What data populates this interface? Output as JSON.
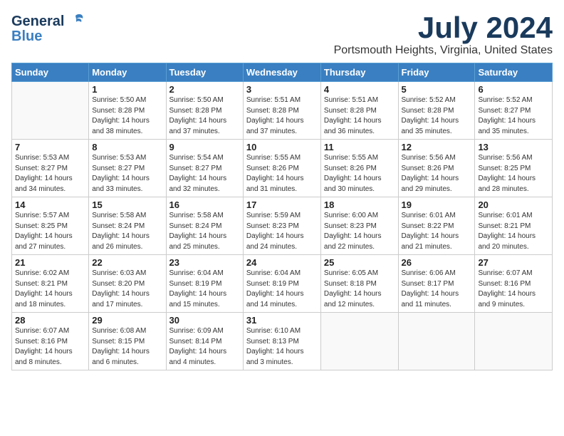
{
  "header": {
    "logo_line1": "General",
    "logo_line2": "Blue",
    "month_year": "July 2024",
    "location": "Portsmouth Heights, Virginia, United States"
  },
  "weekdays": [
    "Sunday",
    "Monday",
    "Tuesday",
    "Wednesday",
    "Thursday",
    "Friday",
    "Saturday"
  ],
  "weeks": [
    [
      {
        "day": "",
        "info": ""
      },
      {
        "day": "1",
        "info": "Sunrise: 5:50 AM\nSunset: 8:28 PM\nDaylight: 14 hours\nand 38 minutes."
      },
      {
        "day": "2",
        "info": "Sunrise: 5:50 AM\nSunset: 8:28 PM\nDaylight: 14 hours\nand 37 minutes."
      },
      {
        "day": "3",
        "info": "Sunrise: 5:51 AM\nSunset: 8:28 PM\nDaylight: 14 hours\nand 37 minutes."
      },
      {
        "day": "4",
        "info": "Sunrise: 5:51 AM\nSunset: 8:28 PM\nDaylight: 14 hours\nand 36 minutes."
      },
      {
        "day": "5",
        "info": "Sunrise: 5:52 AM\nSunset: 8:28 PM\nDaylight: 14 hours\nand 35 minutes."
      },
      {
        "day": "6",
        "info": "Sunrise: 5:52 AM\nSunset: 8:27 PM\nDaylight: 14 hours\nand 35 minutes."
      }
    ],
    [
      {
        "day": "7",
        "info": "Sunrise: 5:53 AM\nSunset: 8:27 PM\nDaylight: 14 hours\nand 34 minutes."
      },
      {
        "day": "8",
        "info": "Sunrise: 5:53 AM\nSunset: 8:27 PM\nDaylight: 14 hours\nand 33 minutes."
      },
      {
        "day": "9",
        "info": "Sunrise: 5:54 AM\nSunset: 8:27 PM\nDaylight: 14 hours\nand 32 minutes."
      },
      {
        "day": "10",
        "info": "Sunrise: 5:55 AM\nSunset: 8:26 PM\nDaylight: 14 hours\nand 31 minutes."
      },
      {
        "day": "11",
        "info": "Sunrise: 5:55 AM\nSunset: 8:26 PM\nDaylight: 14 hours\nand 30 minutes."
      },
      {
        "day": "12",
        "info": "Sunrise: 5:56 AM\nSunset: 8:26 PM\nDaylight: 14 hours\nand 29 minutes."
      },
      {
        "day": "13",
        "info": "Sunrise: 5:56 AM\nSunset: 8:25 PM\nDaylight: 14 hours\nand 28 minutes."
      }
    ],
    [
      {
        "day": "14",
        "info": "Sunrise: 5:57 AM\nSunset: 8:25 PM\nDaylight: 14 hours\nand 27 minutes."
      },
      {
        "day": "15",
        "info": "Sunrise: 5:58 AM\nSunset: 8:24 PM\nDaylight: 14 hours\nand 26 minutes."
      },
      {
        "day": "16",
        "info": "Sunrise: 5:58 AM\nSunset: 8:24 PM\nDaylight: 14 hours\nand 25 minutes."
      },
      {
        "day": "17",
        "info": "Sunrise: 5:59 AM\nSunset: 8:23 PM\nDaylight: 14 hours\nand 24 minutes."
      },
      {
        "day": "18",
        "info": "Sunrise: 6:00 AM\nSunset: 8:23 PM\nDaylight: 14 hours\nand 22 minutes."
      },
      {
        "day": "19",
        "info": "Sunrise: 6:01 AM\nSunset: 8:22 PM\nDaylight: 14 hours\nand 21 minutes."
      },
      {
        "day": "20",
        "info": "Sunrise: 6:01 AM\nSunset: 8:21 PM\nDaylight: 14 hours\nand 20 minutes."
      }
    ],
    [
      {
        "day": "21",
        "info": "Sunrise: 6:02 AM\nSunset: 8:21 PM\nDaylight: 14 hours\nand 18 minutes."
      },
      {
        "day": "22",
        "info": "Sunrise: 6:03 AM\nSunset: 8:20 PM\nDaylight: 14 hours\nand 17 minutes."
      },
      {
        "day": "23",
        "info": "Sunrise: 6:04 AM\nSunset: 8:19 PM\nDaylight: 14 hours\nand 15 minutes."
      },
      {
        "day": "24",
        "info": "Sunrise: 6:04 AM\nSunset: 8:19 PM\nDaylight: 14 hours\nand 14 minutes."
      },
      {
        "day": "25",
        "info": "Sunrise: 6:05 AM\nSunset: 8:18 PM\nDaylight: 14 hours\nand 12 minutes."
      },
      {
        "day": "26",
        "info": "Sunrise: 6:06 AM\nSunset: 8:17 PM\nDaylight: 14 hours\nand 11 minutes."
      },
      {
        "day": "27",
        "info": "Sunrise: 6:07 AM\nSunset: 8:16 PM\nDaylight: 14 hours\nand 9 minutes."
      }
    ],
    [
      {
        "day": "28",
        "info": "Sunrise: 6:07 AM\nSunset: 8:16 PM\nDaylight: 14 hours\nand 8 minutes."
      },
      {
        "day": "29",
        "info": "Sunrise: 6:08 AM\nSunset: 8:15 PM\nDaylight: 14 hours\nand 6 minutes."
      },
      {
        "day": "30",
        "info": "Sunrise: 6:09 AM\nSunset: 8:14 PM\nDaylight: 14 hours\nand 4 minutes."
      },
      {
        "day": "31",
        "info": "Sunrise: 6:10 AM\nSunset: 8:13 PM\nDaylight: 14 hours\nand 3 minutes."
      },
      {
        "day": "",
        "info": ""
      },
      {
        "day": "",
        "info": ""
      },
      {
        "day": "",
        "info": ""
      }
    ]
  ]
}
